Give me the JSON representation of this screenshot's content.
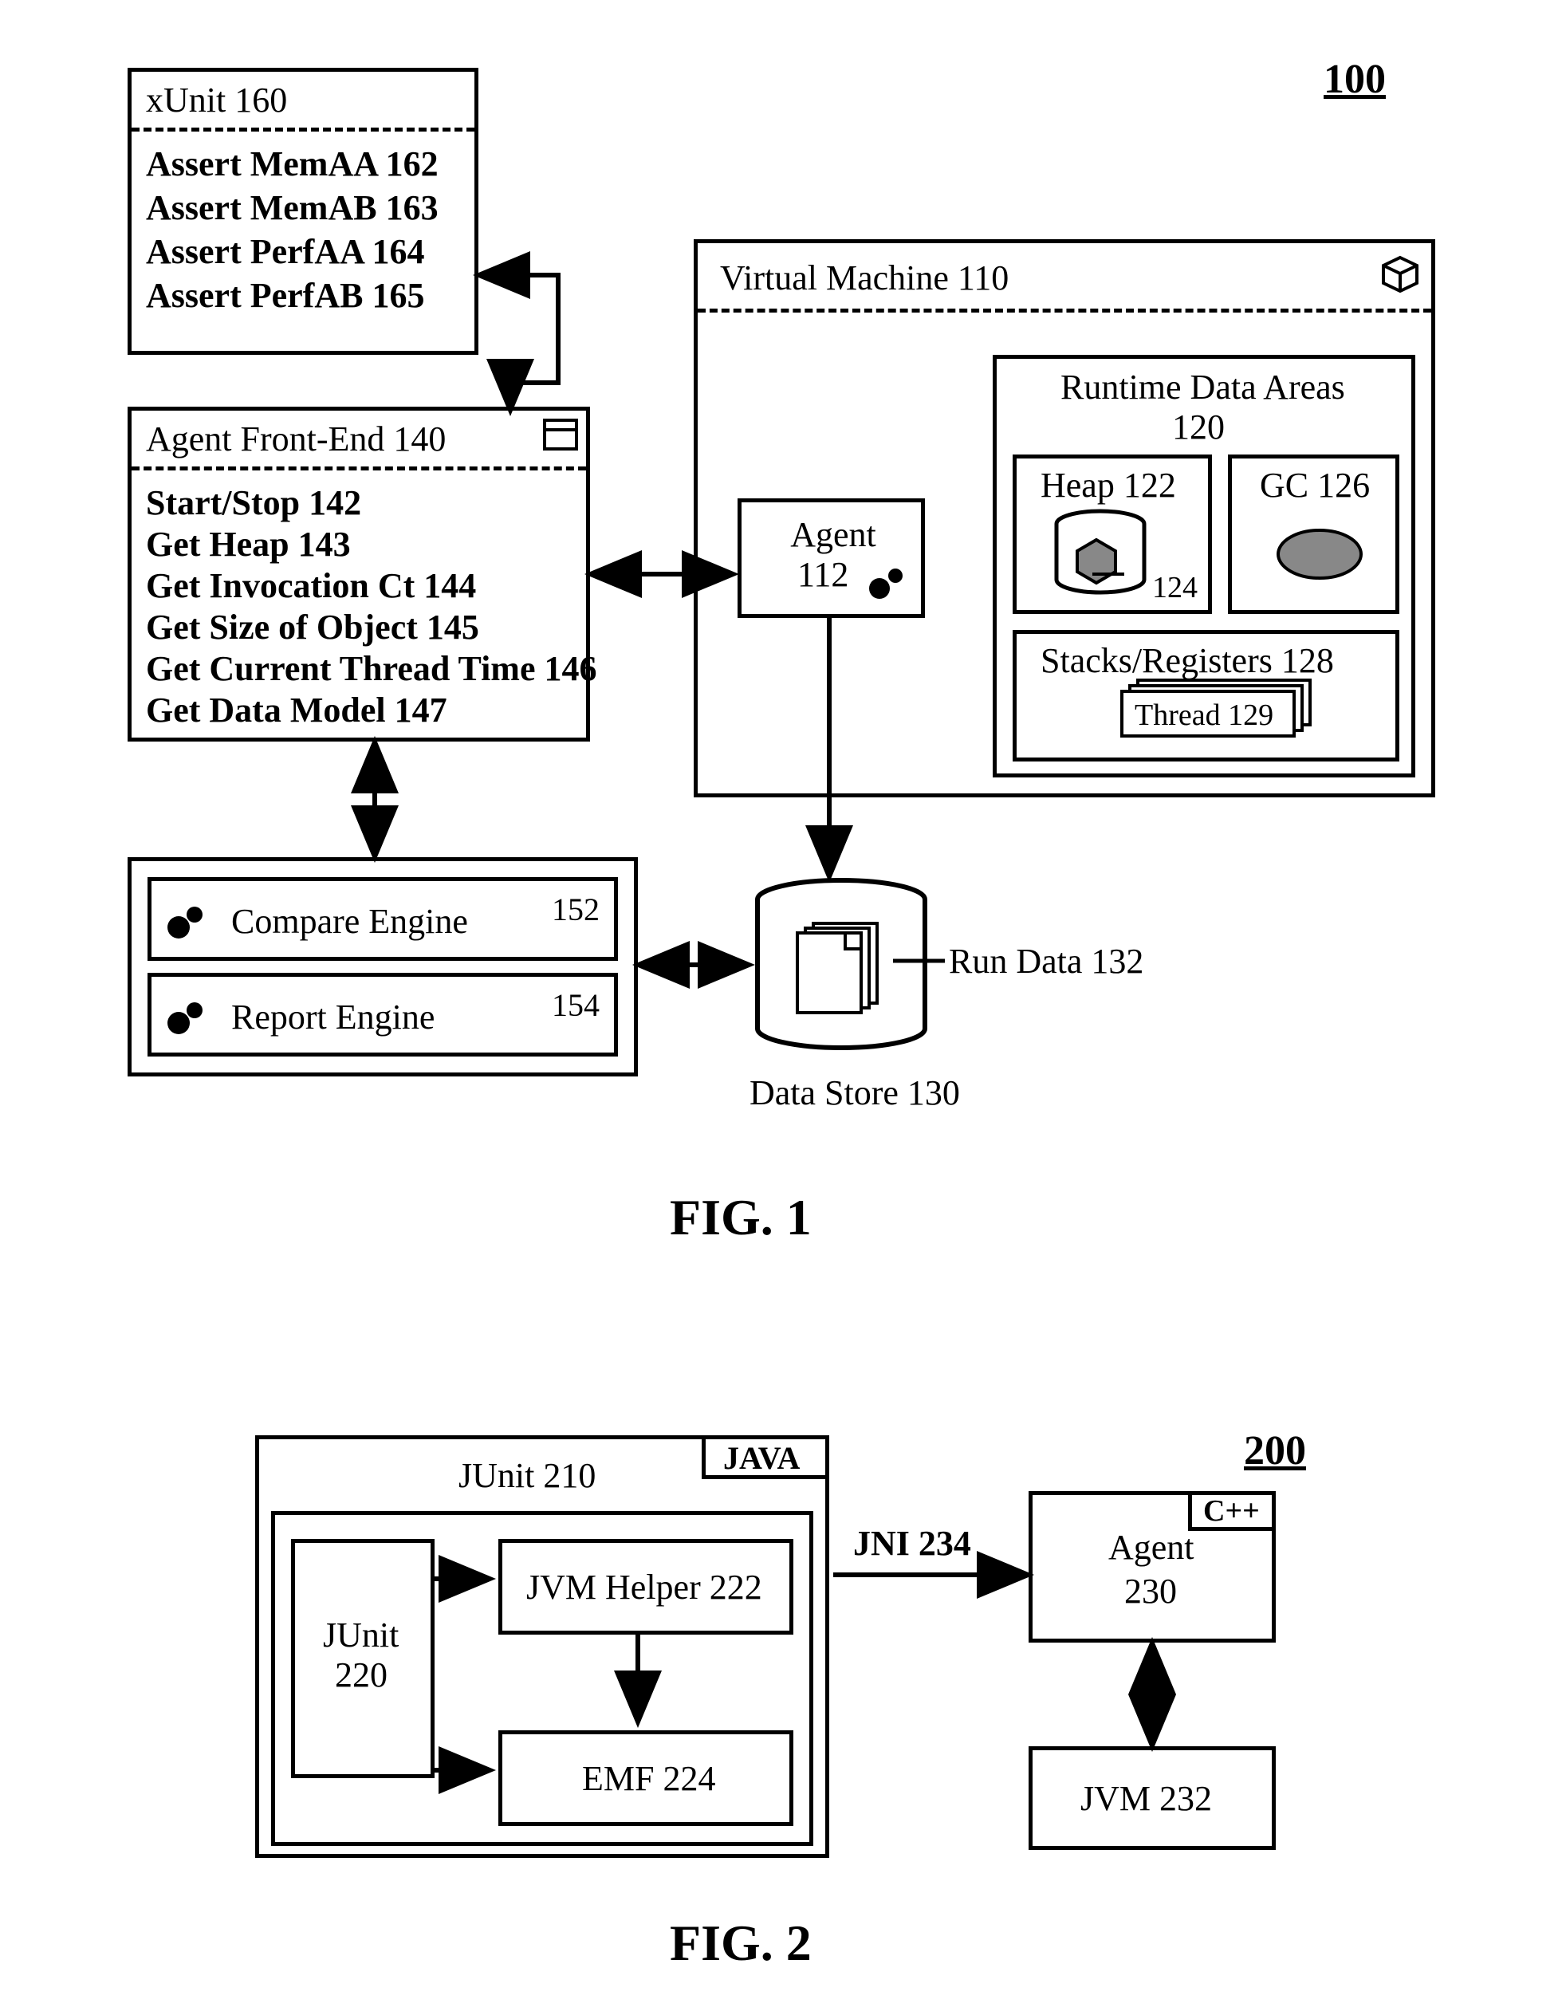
{
  "fig1": {
    "ref": "100",
    "caption": "FIG. 1",
    "xunit": {
      "title": "xUnit 160",
      "items": [
        "Assert MemAA 162",
        "Assert MemAB 163",
        "Assert PerfAA 164",
        "Assert PerfAB 165"
      ]
    },
    "frontend": {
      "title": "Agent Front-End 140",
      "items": [
        "Start/Stop 142",
        "Get Heap 143",
        "Get Invocation Ct 144",
        "Get Size of Object 145",
        "Get Current Thread Time 146",
        "Get Data Model 147"
      ]
    },
    "engines": {
      "compare": {
        "label": "Compare Engine",
        "ref": "152"
      },
      "report": {
        "label": "Report Engine",
        "ref": "154"
      }
    },
    "vm": {
      "title": "Virtual Machine 110",
      "agent": "Agent\n112",
      "rda": {
        "title": "Runtime Data Areas\n120",
        "heap": "Heap 122",
        "heapObj": "124",
        "gc": "GC 126",
        "stacks": "Stacks/Registers 128",
        "thread": "Thread 129"
      }
    },
    "datastore": {
      "rundata": "Run Data 132",
      "label": "Data Store 130"
    }
  },
  "fig2": {
    "ref": "200",
    "caption": "FIG. 2",
    "junitBox": {
      "title": "JUnit 210",
      "lang": "JAVA"
    },
    "junit": "JUnit\n220",
    "jvmHelper": "JVM Helper 222",
    "emf": "EMF 224",
    "jni": "JNI 234",
    "agent": {
      "title": "Agent\n230",
      "lang": "C++"
    },
    "jvm": "JVM 232"
  }
}
